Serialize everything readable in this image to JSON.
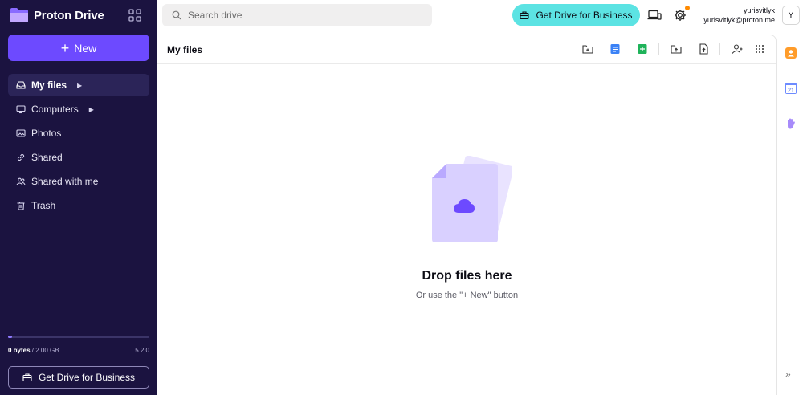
{
  "brand": {
    "name": "Proton Drive",
    "logo_color": "#8a6bff"
  },
  "sidebar": {
    "new_label": "New",
    "items": [
      {
        "label": "My files",
        "icon": "inbox-icon",
        "active": true,
        "has_caret": true
      },
      {
        "label": "Computers",
        "icon": "monitor-icon",
        "active": false,
        "has_caret": true
      },
      {
        "label": "Photos",
        "icon": "image-icon",
        "active": false,
        "has_caret": false
      },
      {
        "label": "Shared",
        "icon": "link-icon",
        "active": false,
        "has_caret": false
      },
      {
        "label": "Shared with me",
        "icon": "users-icon",
        "active": false,
        "has_caret": false
      },
      {
        "label": "Trash",
        "icon": "trash-icon",
        "active": false,
        "has_caret": false
      }
    ],
    "storage": {
      "used": "0 bytes",
      "separator": " / ",
      "total": "2.00 GB",
      "version": "5.2.0",
      "fill_fraction": 0.03
    },
    "business_label": "Get Drive for Business"
  },
  "topbar": {
    "search_placeholder": "Search drive",
    "business_label": "Get Drive for Business",
    "user_name": "yurisvitlyk",
    "user_email": "yurisvitlyk@proton.me",
    "avatar_initial": "Y"
  },
  "main": {
    "title": "My files",
    "empty_title": "Drop files here",
    "empty_subtitle": "Or use the \"+ New\" button"
  },
  "colors": {
    "sidebar_bg": "#1b1340",
    "accent": "#6d4aff",
    "business_cyan": "#5ce3e3",
    "notification": "#ff8a00"
  },
  "rail": {
    "calendar_day": "21"
  }
}
